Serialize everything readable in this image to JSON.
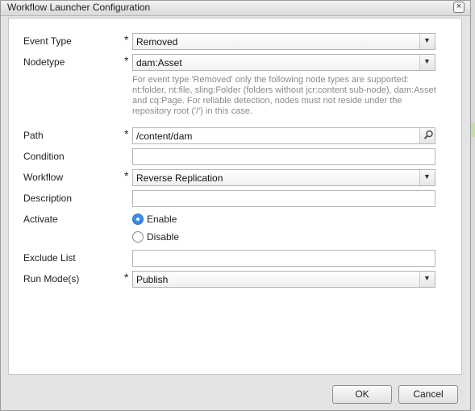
{
  "dialog": {
    "title": "Workflow Launcher Configuration",
    "close_glyph": "×"
  },
  "form": {
    "required_marker": "*",
    "event_type": {
      "label": "Event Type",
      "value": "Removed"
    },
    "nodetype": {
      "label": "Nodetype",
      "value": "dam:Asset",
      "hint": "For event type 'Removed' only the following node types are supported: nt:folder, nt:file, sling:Folder (folders without jcr:content sub-node), dam:Asset and cq:Page. For reliable detection, nodes must not reside under the repository root ('/') in this case."
    },
    "path": {
      "label": "Path",
      "value": "/content/dam"
    },
    "condition": {
      "label": "Condition",
      "value": ""
    },
    "workflow": {
      "label": "Workflow",
      "value": "Reverse Replication"
    },
    "description": {
      "label": "Description",
      "value": ""
    },
    "activate": {
      "label": "Activate",
      "options": [
        {
          "label": "Enable",
          "selected": true
        },
        {
          "label": "Disable",
          "selected": false
        }
      ]
    },
    "exclude_list": {
      "label": "Exclude List",
      "value": ""
    },
    "run_modes": {
      "label": "Run Mode(s)",
      "value": "Publish"
    }
  },
  "buttons": {
    "ok": "OK",
    "cancel": "Cancel"
  },
  "icons": {
    "dropdown": "chevron-down-icon",
    "search": "search-icon",
    "close": "close-icon"
  }
}
